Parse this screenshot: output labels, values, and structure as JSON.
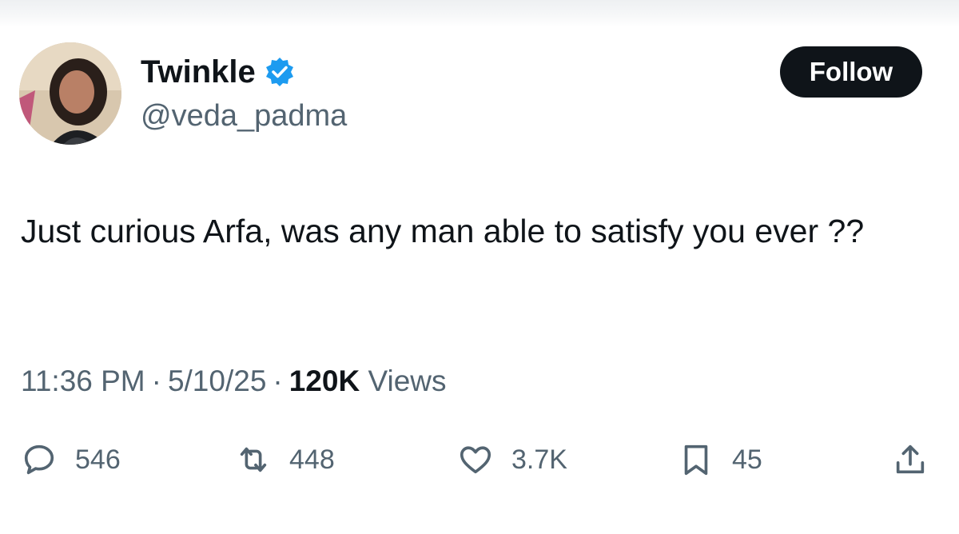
{
  "author": {
    "name": "Twinkle",
    "handle": "@veda_padma",
    "verified": true
  },
  "follow_label": "Follow",
  "tweet": {
    "text": "Just curious Arfa, was any man able to satisfy you ever ??"
  },
  "meta": {
    "time": "11:36 PM",
    "separator": "·",
    "date": "5/10/25",
    "views_count": "120K",
    "views_label": "Views"
  },
  "actions": {
    "replies": "546",
    "reposts": "448",
    "likes": "3.7K",
    "bookmarks": "45"
  },
  "icons": {
    "verified": "verified-badge-icon",
    "reply": "reply-icon",
    "repost": "repost-icon",
    "like": "heart-icon",
    "bookmark": "bookmark-icon",
    "share": "share-icon"
  },
  "colors": {
    "text": "#0f1419",
    "secondary": "#536471",
    "verified_blue": "#1d9bf0",
    "follow_bg": "#0f1419"
  }
}
